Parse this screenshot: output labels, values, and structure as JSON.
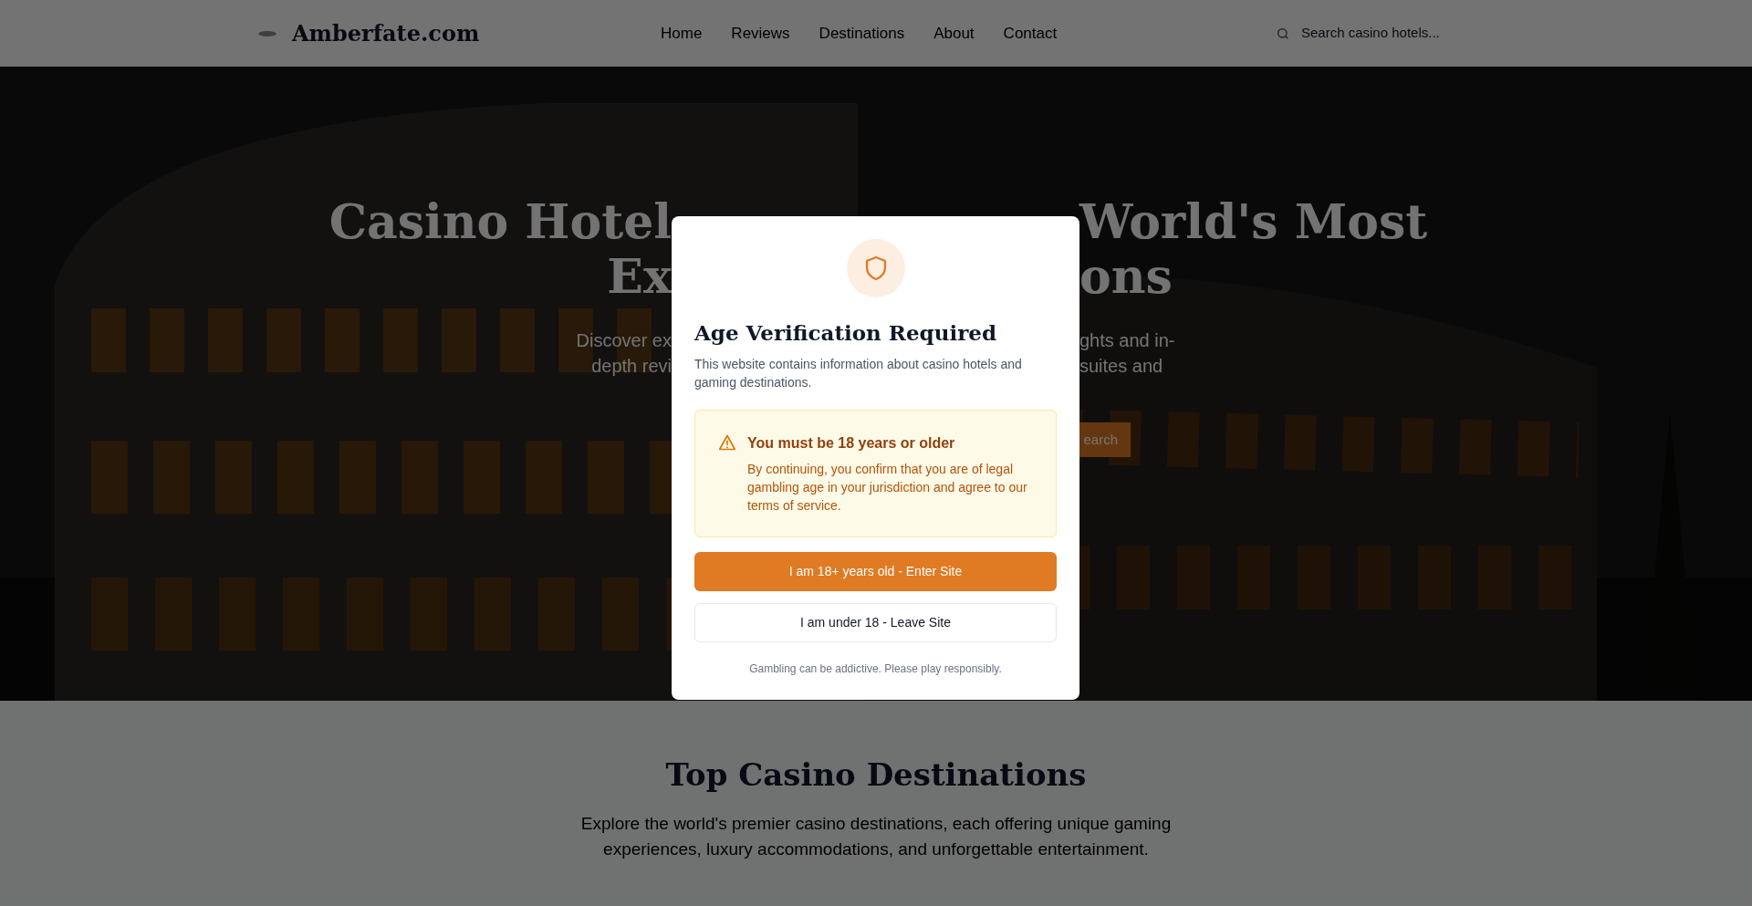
{
  "header": {
    "logo": "Amberfate.com",
    "nav": [
      {
        "label": "Home"
      },
      {
        "label": "Reviews"
      },
      {
        "label": "Destinations"
      },
      {
        "label": "About"
      },
      {
        "label": "Contact"
      }
    ],
    "search": {
      "placeholder": "Search casino hotels..."
    }
  },
  "hero": {
    "title_lines": [
      {
        "left": "Casino Hotel",
        "right": "World's Most"
      },
      {
        "left": "Ex",
        "right": "ons"
      }
    ],
    "subtitle_lines": [
      {
        "left": "Discover ex",
        "right": "ghts and in-"
      },
      {
        "left": "depth revi",
        "right": "suites and"
      }
    ],
    "button": "earch"
  },
  "modal": {
    "title": "Age Verification Required",
    "description": "This website contains information about casino hotels and gaming destinations.",
    "warning": {
      "title": "You must be 18 years or older",
      "text": "By continuing, you confirm that you are of legal gambling age in your jurisdiction and agree to our terms of service."
    },
    "buttons": [
      {
        "kind": "primary",
        "label": "I am 18+ years old - Enter Site"
      },
      {
        "kind": "secondary",
        "label": "I am under 18 - Leave Site"
      }
    ],
    "note": "Gambling can be addictive. Please play responsibly."
  },
  "section": {
    "title": "Top Casino Destinations",
    "text": "Explore the world's premier casino destinations, each offering unique gaming experiences, luxury accommodations, and unforgettable entertainment."
  }
}
